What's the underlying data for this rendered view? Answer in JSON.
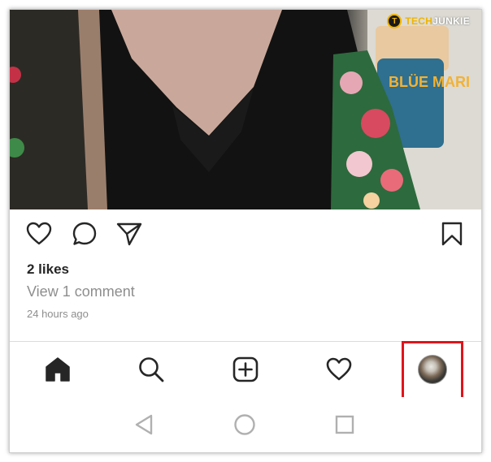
{
  "watermark": {
    "badge_letter": "T",
    "text_part1": "TECH",
    "text_part2": "JUNKIE"
  },
  "post": {
    "likes": "2 likes",
    "view_comments": "View 1 comment",
    "timestamp": "24 hours ago",
    "photo_sign_text": "BLÜE MARI"
  },
  "actions": {
    "icons": [
      "heart-outline",
      "comment-bubble",
      "paper-plane",
      "bookmark-outline"
    ]
  },
  "bottom_nav": {
    "items": [
      "home-filled",
      "search",
      "new-post-plus",
      "activity-heart",
      "profile-avatar"
    ],
    "highlighted": "profile-avatar",
    "highlight_color": "#e0141b"
  },
  "system_nav": {
    "items": [
      "back-triangle",
      "home-circle",
      "recents-square"
    ],
    "color": "#b0b0b0"
  },
  "colors": {
    "text": "#262626",
    "secondary": "#8e8e8e",
    "divider": "#dbdbdb"
  }
}
